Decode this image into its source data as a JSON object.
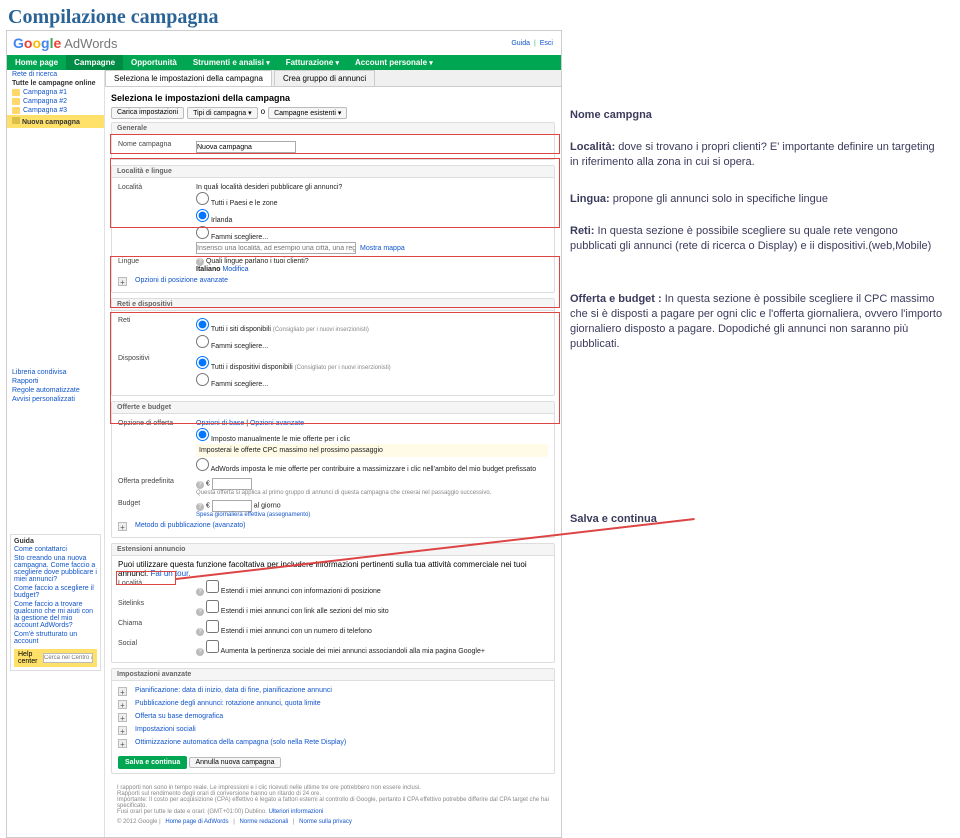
{
  "slide_title": "Compilazione campagna",
  "logo": {
    "google": "Google",
    "adwords": "AdWords"
  },
  "toplinks": {
    "guida": "Guida",
    "esci": "Esci"
  },
  "mainnav": [
    "Home page",
    "Campagne",
    "Opportunità",
    "Strumenti e analisi",
    "Fatturazione",
    "Account personale"
  ],
  "side": {
    "rete": "Rete di ricerca",
    "all_online": "Tutte le campagne online",
    "camps": [
      "Campagna #1",
      "Campagna #2",
      "Campagna #3"
    ],
    "new": "Nuova campagna",
    "libreria": "Libreria condivisa",
    "rapporti": "Rapporti",
    "regole": "Regole automatizzate",
    "avvisi": "Avvisi personalizzati",
    "guida": {
      "title": "Guida",
      "items": [
        "Come contattarci",
        "Sto creando una nuova campagna. Come faccio a scegliere dove pubblicare i miei annunci?",
        "Come faccio a scegliere il budget?",
        "Come faccio a trovare qualcuno che mi aiuti con la gestione del mio account AdWords?",
        "Com'è strutturato un account"
      ],
      "help_center": "Help center",
      "search_ph": "Cerca nel Centro assi"
    }
  },
  "tabs": {
    "sel": "Seleziona le impostazioni della campagna",
    "crea": "Crea gruppo di annunci"
  },
  "panel_title": "Seleziona le impostazioni della campagna",
  "search_row": {
    "carica": "Carica impostazioni",
    "tipo": "Tipi di campagna",
    "o": "o",
    "esist": "Campagne esistenti"
  },
  "generale": {
    "head": "Generale",
    "label": "Nome campagna",
    "btn": "Nuova campagna"
  },
  "loc_ling": {
    "head": "Località e lingue",
    "localita_label": "Località",
    "localita_q": "In quali località desideri pubblicare gli annunci?",
    "opts": [
      "Tutti i Paesi e le zone",
      "Irlanda",
      "Fammi scegliere..."
    ],
    "hint": "Inserisci una località, ad esempio una città, una regione o un p",
    "mostra": "Mostra mappa",
    "lingue_label": "Lingue",
    "lingue_q": "Quali lingue parlano i tuoi clienti?",
    "lingua": "Italiano",
    "modifica": "Modifica",
    "opzioni_pos": "Opzioni di posizione avanzate"
  },
  "reti": {
    "head": "Reti e dispositivi",
    "reti_label": "Reti",
    "reti_opts": [
      "Tutti i siti disponibili",
      "Fammi scegliere..."
    ],
    "reti_hint": "(Consigliato per i nuovi inserzionisti)",
    "disp_label": "Dispositivi",
    "disp_opts": [
      "Tutti i dispositivi disponibili",
      "Fammi scegliere..."
    ],
    "disp_hint": "(Consigliato per i nuovi inserzionisti)"
  },
  "offerte": {
    "head": "Offerte e budget",
    "opz_label": "Opzione di offerta",
    "basic": "Opzioni di base",
    "adv": "Opzioni avanzate",
    "manual": "Imposto manualmente le mie offerte per i clic",
    "prev": "Imposterai le offerte CPC massimo nel prossimo passaggio",
    "awnote": "AdWords imposta le mie offerte per contribuire a massimizzare i clic nell'ambito del mio budget prefissato",
    "pred_label": "Offerta predefinita",
    "pred_cur": "€",
    "budget_label": "Budget",
    "budget_note": "Questa offerta si applica al primo gruppo di annunci di questa campagna che creerai nel passaggio successivo.",
    "budget_cur": "€",
    "al_giorno": "al giorno",
    "spesa": "Spesa giornaliera effettiva (assegnamento)",
    "metodo": "Metodo di pubblicazione (avanzato)"
  },
  "ext": {
    "head": "Estensioni annuncio",
    "intro": "Puoi utilizzare questa funzione facoltativa per includere informazioni pertinenti sulla tua attività commerciale nei tuoi annunci.",
    "tour": "Fai un tour.",
    "rows": {
      "loc": "Località",
      "loc_txt": "Estendi i miei annunci con informazioni di posizione",
      "site": "Sitelinks",
      "site_txt": "Estendi i miei annunci con link alle sezioni del mio sito",
      "call": "Chiama",
      "call_txt": "Estendi i miei annunci con un numero di telefono",
      "soc": "Social",
      "soc_txt": "Aumenta la pertinenza sociale dei miei annunci associandoli alla mia pagina Google+"
    }
  },
  "adv": {
    "head": "Impostazioni avanzate",
    "items": [
      "Pianificazione: data di inizio, data di fine, pianificazione annunci",
      "Pubblicazione degli annunci: rotazione annunci, quota limite",
      "Offerta su base demografica",
      "Impostazioni sociali",
      "Ottimizzazione automatica della campagna (solo nella Rete Display)"
    ],
    "save": "Salva e continua",
    "cancel": "Annulla nuova campagna"
  },
  "footer": {
    "disclaim": "I rapporti non sono in tempo reale. Le impressioni e i clic ricevuti nelle ultime tre ore potrebbero non essere inclusi.",
    "disc2": "Rapporti sul rendimento degli orari di conversione hanno un ritardo di 24 ore.",
    "disc3": "Importante: Il costo per acquisizione (CPA) effettivo è legato a fattori esterni al controllo di Google, pertanto il CPA effettivo potrebbe differire dal CPA target che hai specificato.",
    "disc4": "Fusi orari per tutte le date e orari: (GMT+01:00) Dublino.",
    "more": "Ulteriori informazioni",
    "copy": "© 2012 Google",
    "l1": "Home page di AdWords",
    "l2": "Norme redazionali",
    "l3": "Norme sulla privacy"
  },
  "annot": {
    "nome": "Nome campgna",
    "localita": "Località: dove si trovano i propri clienti? E' importante definire un targeting in riferimento alla zona in cui si opera.",
    "lingua": "Lingua: propone gli annunci solo in specifiche lingue",
    "reti": "Reti: In questa sezione è possibile scegliere su quale rete vengono pubblicati gli annunci (rete di ricerca o Display) e ii dispositivi.(web,Mobile)",
    "offerta": "Offerta e budget : In questa sezione è possibile scegliere il CPC massimo che si è disposti a pagare per ogni clic e l'offerta giornaliera, ovvero l'importo giornaliero disposto a pagare. Dopodiché gli annunci non saranno più pubblicati.",
    "salva": "Salva e continua"
  }
}
